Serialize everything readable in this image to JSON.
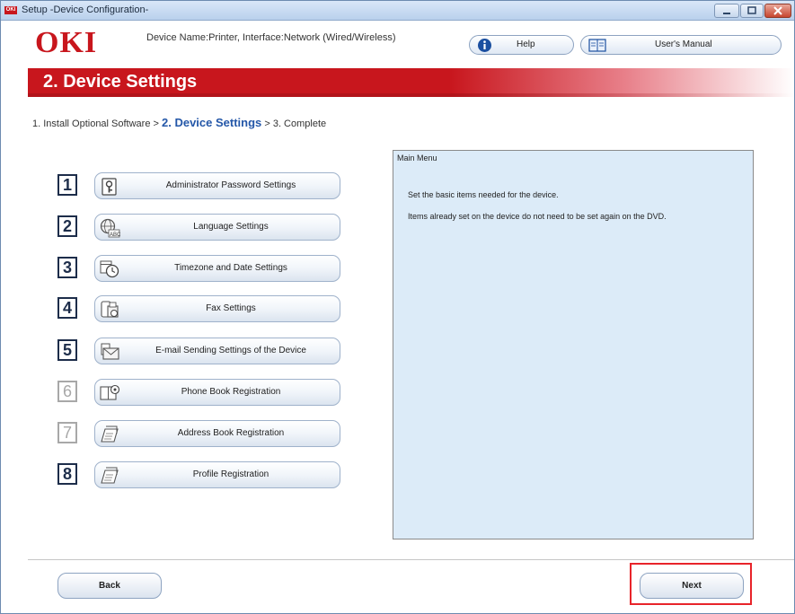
{
  "window": {
    "title": "Setup -Device Configuration-",
    "app_icon_text": "OKI"
  },
  "header": {
    "logo": "OKI",
    "device_name": "Device Name:Printer, Interface:Network (Wired/Wireless)",
    "help_label": "Help",
    "manual_label": "User's Manual"
  },
  "banner": {
    "title": "2. Device Settings",
    "color": "#c8161d"
  },
  "breadcrumb": {
    "step1": "1. Install Optional Software >",
    "step2": "2. Device Settings",
    "step3": "> 3. Complete"
  },
  "menu": {
    "items": [
      {
        "number": "1",
        "label": "Administrator Password Settings",
        "icon": "key-icon",
        "enabled": true
      },
      {
        "number": "2",
        "label": "Language Settings",
        "icon": "globe-abc-icon",
        "enabled": true
      },
      {
        "number": "3",
        "label": "Timezone and Date Settings",
        "icon": "clock-icon",
        "enabled": true
      },
      {
        "number": "4",
        "label": "Fax Settings",
        "icon": "fax-icon",
        "enabled": true
      },
      {
        "number": "5",
        "label": "E-mail Sending Settings of the Device",
        "icon": "mail-icon",
        "enabled": true
      },
      {
        "number": "6",
        "label": "Phone Book Registration",
        "icon": "phonebook-icon",
        "enabled": false
      },
      {
        "number": "7",
        "label": "Address Book Registration",
        "icon": "address-book-icon",
        "enabled": false
      },
      {
        "number": "8",
        "label": "Profile Registration",
        "icon": "profile-icon",
        "enabled": true
      }
    ]
  },
  "info": {
    "heading": "Main Menu",
    "line1": "Set the basic items needed for the device.",
    "line2": "Items already set on the device do not need to be set again on the DVD."
  },
  "footer": {
    "back_label": "Back",
    "next_label": "Next",
    "highlight_color": "#e8242a"
  }
}
